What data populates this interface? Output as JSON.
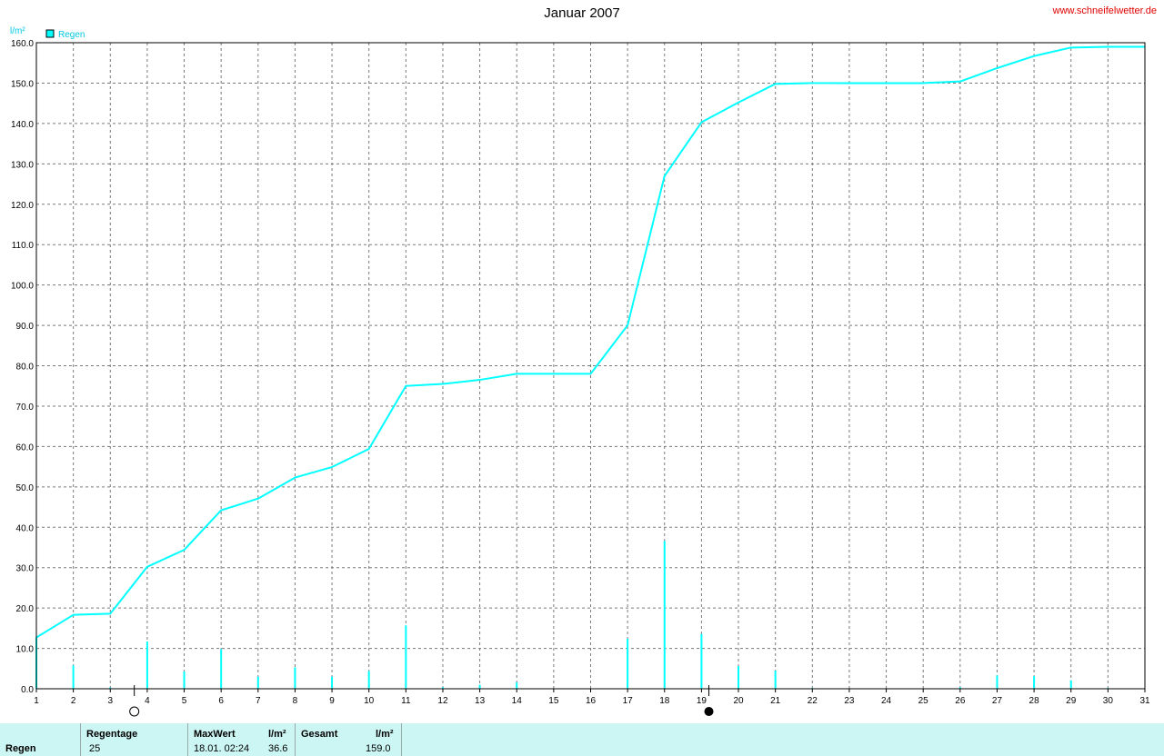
{
  "header": {
    "title": "Januar 2007",
    "website": "www.schneifelwetter.de"
  },
  "chart_data": {
    "type": "line+bar",
    "title": "Januar 2007",
    "ylabel": "l/m²",
    "ylim": [
      0,
      160
    ],
    "yticks": [
      "0.0",
      "10.0",
      "20.0",
      "30.0",
      "40.0",
      "50.0",
      "60.0",
      "70.0",
      "80.0",
      "90.0",
      "100.0",
      "110.0",
      "120.0",
      "130.0",
      "140.0",
      "150.0",
      "160.0"
    ],
    "xlim": [
      1,
      31
    ],
    "xticks": [
      "1",
      "2",
      "3",
      "4",
      "5",
      "6",
      "7",
      "8",
      "9",
      "10",
      "11",
      "12",
      "13",
      "14",
      "15",
      "16",
      "17",
      "18",
      "19",
      "20",
      "21",
      "22",
      "23",
      "24",
      "25",
      "26",
      "27",
      "28",
      "29",
      "30",
      "31"
    ],
    "grid": true,
    "legend": {
      "placement": "top-left",
      "label": "Regen"
    },
    "series": [
      {
        "name": "Regen",
        "kind": "cumulative-line",
        "color": "#00ffff",
        "x": [
          1,
          2,
          3,
          4,
          5,
          6,
          7,
          8,
          9,
          10,
          11,
          12,
          13,
          14,
          15,
          16,
          17,
          18,
          19,
          20,
          21,
          22,
          23,
          24,
          25,
          26,
          27,
          28,
          29,
          30,
          31
        ],
        "values": [
          12.7,
          18.3,
          18.6,
          30.2,
          34.4,
          44.2,
          47.1,
          52.3,
          54.9,
          59.4,
          75.0,
          75.5,
          76.5,
          78.0,
          78.0,
          78.0,
          90.0,
          127.0,
          140.3,
          145.2,
          149.8,
          150.0,
          150.0,
          150.0,
          150.0,
          150.4,
          153.7,
          156.7,
          158.8,
          159.0,
          159.0
        ]
      },
      {
        "name": "Regen (täglich)",
        "kind": "daily-bars",
        "color": "#00ffff",
        "x": [
          1,
          2,
          3,
          4,
          5,
          6,
          7,
          8,
          9,
          10,
          11,
          12,
          13,
          14,
          15,
          16,
          17,
          18,
          19,
          20,
          21,
          22,
          23,
          24,
          25,
          26,
          27,
          28,
          29,
          30,
          31
        ],
        "values": [
          12.7,
          5.8,
          0.3,
          11.7,
          4.3,
          9.8,
          3.0,
          5.3,
          3.0,
          4.4,
          15.7,
          0.4,
          1.0,
          1.6,
          0,
          0,
          12.4,
          36.6,
          13.6,
          5.6,
          4.5,
          0.2,
          0,
          0,
          0,
          0.4,
          3.3,
          3.1,
          2.1,
          0.2,
          0
        ]
      }
    ],
    "annotations": {
      "full_moon_day": 3.65,
      "new_moon_day": 19.2
    }
  },
  "stats": {
    "row_label": "Regen",
    "regentage_label": "Regentage",
    "regentage_value": "25",
    "maxwert_label": "MaxWert",
    "maxwert_unit": "l/m²",
    "maxwert_date": "18.01.  02:24",
    "maxwert_value": "36.6",
    "gesamt_label": "Gesamt",
    "gesamt_unit": "l/m²",
    "gesamt_value": "159.0"
  }
}
